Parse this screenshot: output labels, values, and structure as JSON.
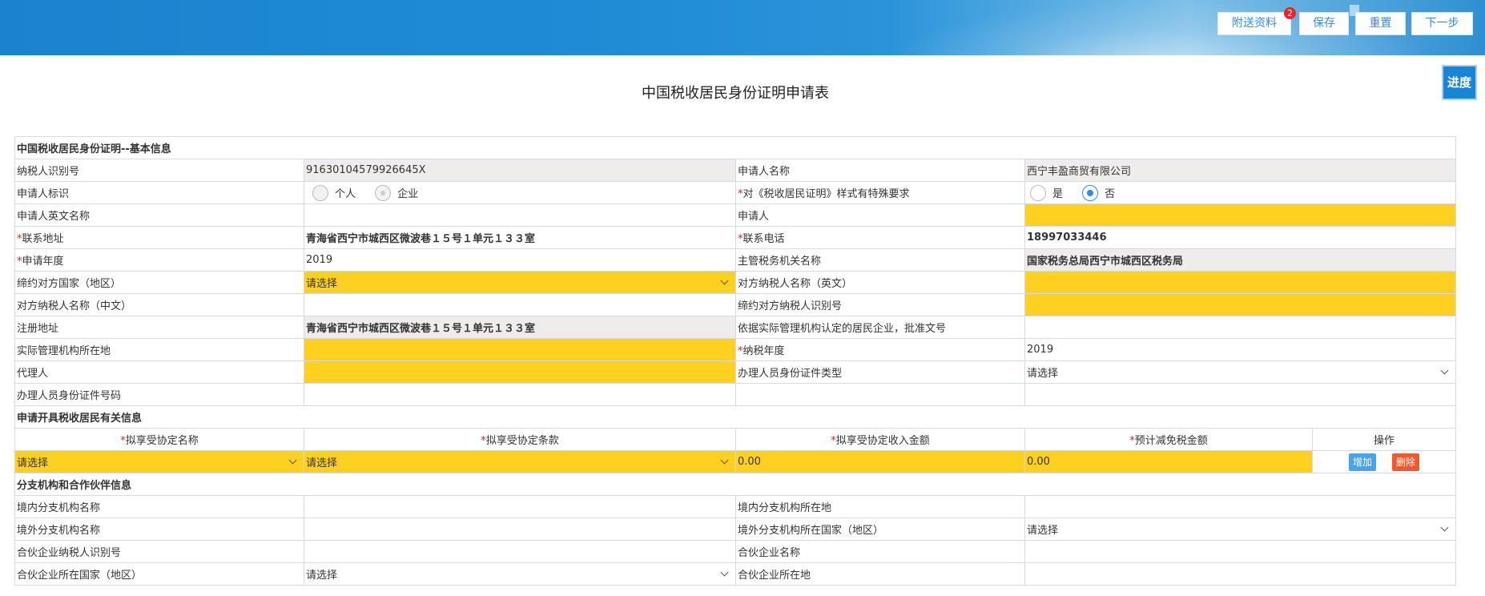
{
  "toolbar": {
    "attach_label": "附送资料",
    "attach_badge": "2",
    "save_label": "保存",
    "reset_label": "重置",
    "next_label": "下一步"
  },
  "page": {
    "title": "中国税收居民身份证明申请表",
    "progress_label": "进度"
  },
  "colors": {
    "required": "#ffd01f",
    "primary": "#2d8cf0",
    "add": "#4aa3e8",
    "delete": "#f05a2a"
  },
  "basic": {
    "section_title": "中国税收居民身份证明--基本信息",
    "taxpayer_id_label": "纳税人识别号",
    "taxpayer_id_value": "91630104579926645X",
    "applicant_name_label": "申请人名称",
    "applicant_name_value": "西宁丰盈商贸有限公司",
    "applicant_type_label": "申请人标识",
    "applicant_type_opt1": "个人",
    "applicant_type_opt2": "企业",
    "special_format_label": "对《税收居民证明》样式有特殊要求",
    "special_format_yes": "是",
    "special_format_no": "否",
    "english_name_label": "申请人英文名称",
    "english_name_value": "",
    "applicant_label": "申请人",
    "applicant_value": "",
    "address_label": "联系地址",
    "address_value": "青海省西宁市城西区微波巷１５号１单元１３３室",
    "phone_label": "联系电话",
    "phone_value": "18997033446",
    "year_label": "申请年度",
    "year_value": "2019",
    "tax_office_label": "主管税务机关名称",
    "tax_office_value": "国家税务总局西宁市城西区税务局",
    "country_label": "缔约对方国家（地区）",
    "country_value": "请选择",
    "counter_en_label": "对方纳税人名称（英文）",
    "counter_en_value": "",
    "counter_cn_label": "对方纳税人名称（中文）",
    "counter_cn_value": "",
    "counter_id_label": "缔约对方纳税人识别号",
    "counter_id_value": "",
    "reg_address_label": "注册地址",
    "reg_address_value": "青海省西宁市城西区微波巷１５号１单元１３３室",
    "approval_doc_label": "依据实际管理机构认定的居民企业，批准文号",
    "approval_doc_value": "",
    "mgmt_location_label": "实际管理机构所在地",
    "mgmt_location_value": "",
    "tax_year_label": "纳税年度",
    "tax_year_value": "2019",
    "agent_label": "代理人",
    "agent_value": "",
    "handler_id_type_label": "办理人员身份证件类型",
    "handler_id_type_value": "请选择",
    "handler_id_no_label": "办理人员身份证件号码",
    "handler_id_no_value": ""
  },
  "treaty": {
    "section_title": "申请开具税收居民有关信息",
    "col_agreement": "拟享受协定名称",
    "col_clause": "拟享受协定条款",
    "col_income": "拟享受协定收入金额",
    "col_exempt": "预计减免税金额",
    "col_action": "操作",
    "agreement_value": "请选择",
    "clause_value": "请选择",
    "income_value": "0.00",
    "exempt_value": "0.00",
    "add_label": "增加",
    "delete_label": "删除"
  },
  "branch": {
    "section_title": "分支机构和合作伙伴信息",
    "domestic_name_label": "境内分支机构名称",
    "domestic_name_value": "",
    "domestic_loc_label": "境内分支机构所在地",
    "domestic_loc_value": "",
    "foreign_name_label": "境外分支机构名称",
    "foreign_name_value": "",
    "foreign_country_label": "境外分支机构所在国家（地区）",
    "foreign_country_value": "请选择",
    "partner_id_label": "合伙企业纳税人识别号",
    "partner_id_value": "",
    "partner_name_label": "合伙企业名称",
    "partner_name_value": "",
    "partner_country_label": "合伙企业所在国家（地区）",
    "partner_country_value": "请选择",
    "partner_loc_label": "合伙企业所在地",
    "partner_loc_value": ""
  }
}
